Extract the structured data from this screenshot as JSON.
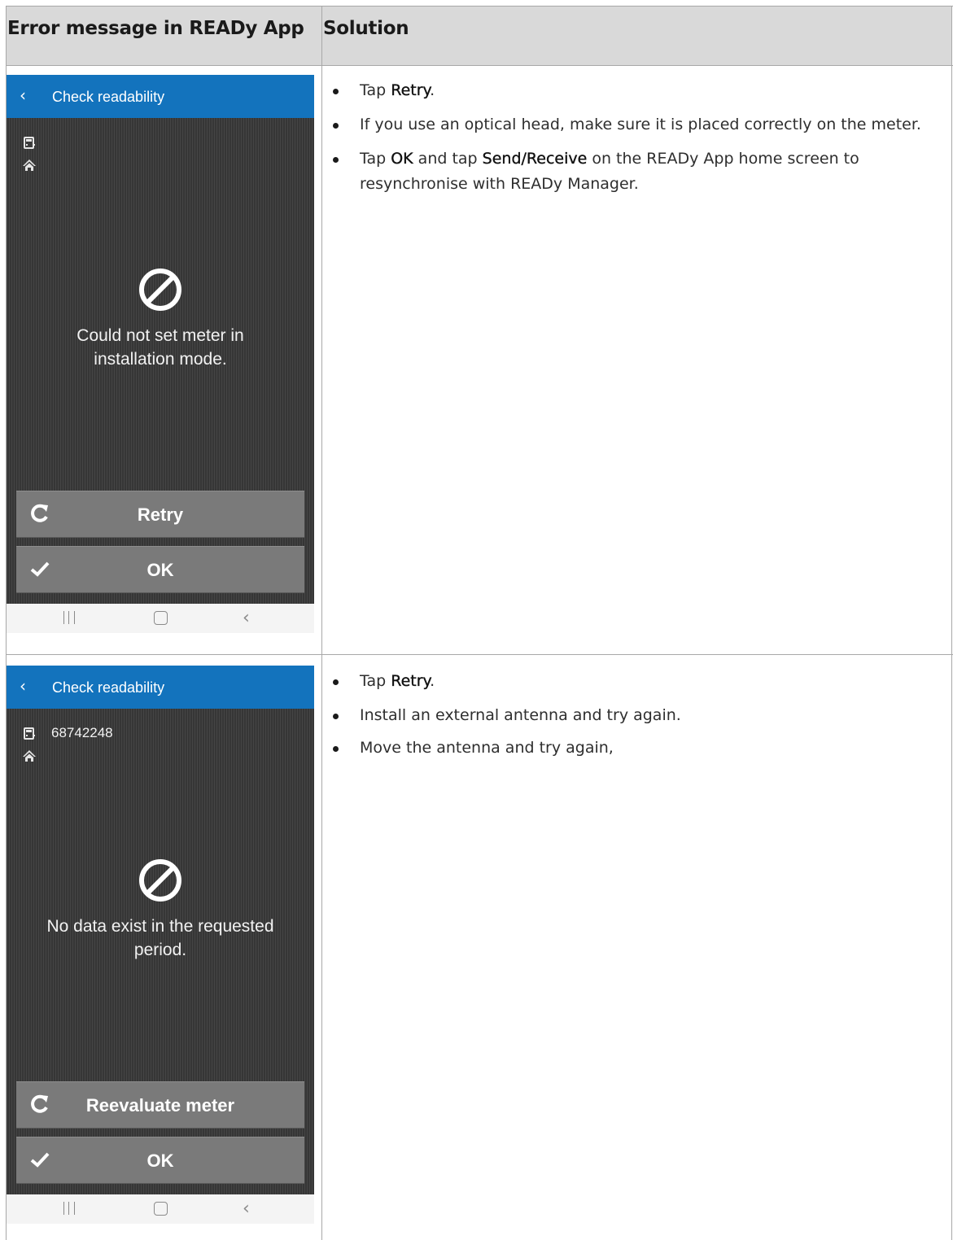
{
  "table": {
    "col1_header": "Error message in READy App",
    "col2_header": "Solution"
  },
  "rows": [
    {
      "screen": {
        "title": "Check readability",
        "meter_number": "",
        "message": "Could not set meter in installation mode.",
        "button_primary": "Retry",
        "button_secondary": "OK"
      },
      "solution": [
        {
          "pre": "Tap ",
          "bold": "Retry",
          "mid": ".",
          "bold2": "",
          "post": ""
        },
        {
          "pre": "If you use an optical head, make sure it is placed correctly on the meter.",
          "bold": "",
          "mid": "",
          "bold2": "",
          "post": ""
        },
        {
          "pre": "Tap ",
          "bold": "OK",
          "mid": " and tap ",
          "bold2": "Send/Receive",
          "post": " on the READy App home screen to resynchronise with READy Manager."
        }
      ]
    },
    {
      "screen": {
        "title": "Check readability",
        "meter_number": "68742248",
        "message": "No data exist in the requested period.",
        "button_primary": "Reevaluate meter",
        "button_secondary": "OK"
      },
      "solution": [
        {
          "pre": "Tap ",
          "bold": "Retry",
          "mid": ".",
          "bold2": "",
          "post": ""
        },
        {
          "pre": "Install an external antenna and try again.",
          "bold": "",
          "mid": "",
          "bold2": "",
          "post": ""
        },
        {
          "pre": "Move the antenna and try again,",
          "bold": "",
          "mid": "",
          "bold2": "",
          "post": ""
        }
      ]
    }
  ],
  "icons": {
    "back": "chevron-left-icon",
    "meter": "meter-icon",
    "home": "home-icon",
    "error": "prohibited-icon",
    "retry": "refresh-icon",
    "ok": "checkmark-icon",
    "nav_recent": "recent-apps-icon",
    "nav_home": "home-button-icon",
    "nav_back": "back-icon"
  },
  "colors": {
    "app_bar": "#1373bd",
    "header_bg": "#d9d9d9",
    "button_bg": "#7a7a7a"
  }
}
